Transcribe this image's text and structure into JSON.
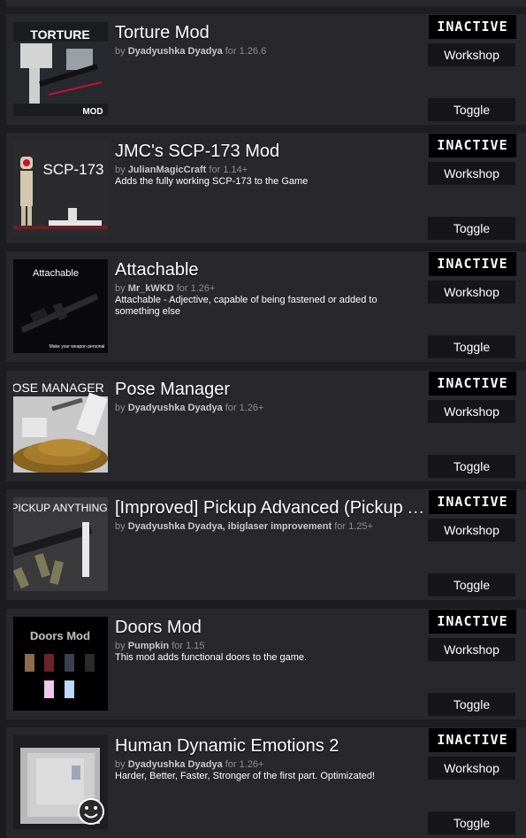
{
  "mods": [
    {
      "title": "Torture Mod",
      "by": "by",
      "author": "Dyadyushka Dyadya",
      "for_text": "for 1.26.6",
      "description": "",
      "status": "INACTIVE",
      "workshop_label": "Workshop",
      "toggle_label": "Toggle",
      "thumb_text": [
        "TORTURE",
        "MOD"
      ]
    },
    {
      "title": "JMC's SCP-173 Mod",
      "by": "by",
      "author": "JulianMagicCraft",
      "for_text": "for 1.14+",
      "description": "Adds the fully working SCP-173 to the Game",
      "status": "INACTIVE",
      "workshop_label": "Workshop",
      "toggle_label": "Toggle",
      "thumb_text": [
        "SCP-173"
      ]
    },
    {
      "title": "Attachable",
      "by": "by",
      "author": "Mr_kWKD",
      "for_text": "for 1.26+",
      "description": "Attachable - Adjective, capable of being fastened or added to something else",
      "status": "INACTIVE",
      "workshop_label": "Workshop",
      "toggle_label": "Toggle",
      "thumb_text": [
        "Attachable",
        "Make your weapon personal"
      ]
    },
    {
      "title": "Pose Manager",
      "by": "by",
      "author": "Dyadyushka Dyadya",
      "for_text": "for 1.26+",
      "description": "",
      "status": "INACTIVE",
      "workshop_label": "Workshop",
      "toggle_label": "Toggle",
      "thumb_text": [
        "POSE MANAGER"
      ]
    },
    {
      "title": "[Improved] Pickup Advanced (Pickup Anything)",
      "by": "by",
      "author": "Dyadyushka Dyadya, ibiglaser improvement",
      "for_text": "for 1.25+",
      "description": "",
      "status": "INACTIVE",
      "workshop_label": "Workshop",
      "toggle_label": "Toggle",
      "thumb_text": [
        "PICKUP ANYTHING"
      ]
    },
    {
      "title": "Doors Mod",
      "by": "by",
      "author": "Pumpkin",
      "for_text": "for 1.15",
      "description": "This mod adds functional doors to the game.",
      "status": "INACTIVE",
      "workshop_label": "Workshop",
      "toggle_label": "Toggle",
      "thumb_text": [
        "Doors Mod"
      ]
    },
    {
      "title": "Human Dynamic Emotions 2",
      "by": "by",
      "author": "Dyadyushka Dyadya",
      "for_text": "for 1.26+",
      "description": "Harder, Better, Faster, Stronger of the first part. Optimizated!",
      "status": "INACTIVE",
      "workshop_label": "Workshop",
      "toggle_label": "Toggle",
      "thumb_text": []
    }
  ],
  "colors": {
    "background": "#1d1d21",
    "card": "#27272c",
    "button": "#161619",
    "status_badge": "#000000"
  }
}
